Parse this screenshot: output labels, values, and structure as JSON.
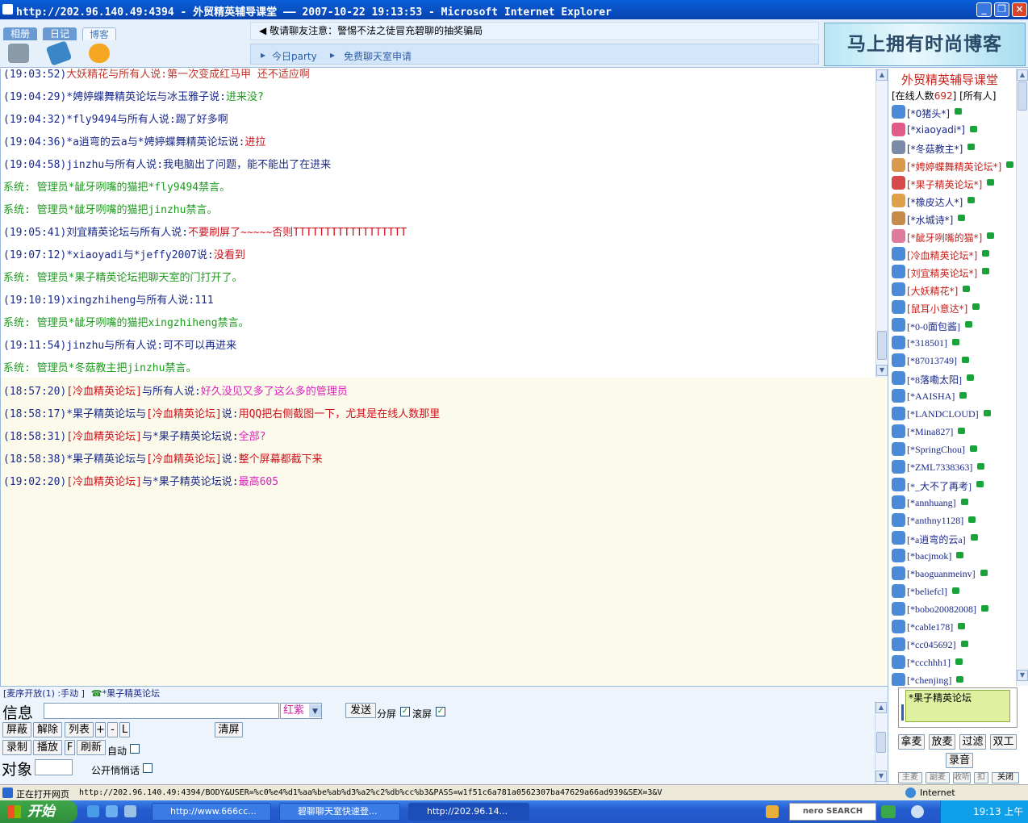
{
  "window": {
    "title": "http://202.96.140.49:4394 - 外贸精英辅导课堂 —— 2007-10-22 19:13:53 - Microsoft Internet Explorer"
  },
  "header": {
    "tabs": [
      "相册",
      "日记",
      "博客"
    ],
    "notice": "敬请聊友注意：警惕不法之徒冒充碧聊的抽奖骗局",
    "links": [
      "今日party",
      "免费聊天室申请"
    ],
    "banner": "马上拥有时尚博客"
  },
  "chat": {
    "lines": [
      {
        "time": "(19:03:52)",
        "text": "大妖精花与所有人说:第一次变成红马甲 还不适应啊"
      },
      {
        "time": "(19:04:29)",
        "sender": "*娉婷蝶舞精英论坛",
        "mid": "与冰玉雅子说:",
        "msg": "进来没?"
      },
      {
        "time": "(19:04:32)",
        "sender": "*fly9494",
        "mid": "与所有人说:",
        "msg": "踢了好多啊"
      },
      {
        "time": "(19:04:36)",
        "sender": "*a逍弯的云a",
        "mid": "与*娉婷蝶舞精英论坛说:",
        "msg": "进拉"
      },
      {
        "time": "(19:04:58)",
        "sender": "jinzhu",
        "mid": "与所有人说:",
        "msg": "我电脑出了问题，能不能出了在进来"
      },
      {
        "system": "系统:  管理员*龇牙咧嘴的猫把*fly9494禁言。"
      },
      {
        "system": "系统:  管理员*龇牙咧嘴的猫把jinzhu禁言。"
      },
      {
        "time": "(19:05:41)",
        "sender": "刘宜精英论坛",
        "mid": "与所有人说:",
        "msg": "不要刷屏了~~~~~否则TTTTTTTTTTTTTTTTTT"
      },
      {
        "time": "(19:07:12)",
        "sender": "*xiaoyadi",
        "mid": "与*jeffy2007说:",
        "msg": "没看到"
      },
      {
        "system": "系统:  管理员*果子精英论坛把聊天室的门打开了。"
      },
      {
        "time": "(19:10:19)",
        "sender": "xingzhiheng",
        "mid": "与所有人说:",
        "msg": "111"
      },
      {
        "system": "系统:  管理员*龇牙咧嘴的猫把xingzhiheng禁言。"
      },
      {
        "time": "(19:11:54)",
        "sender": "jinzhu",
        "mid": "与所有人说:",
        "msg": "可不可以再进来"
      },
      {
        "system": "系统:  管理员*冬菇教主把jinzhu禁言。"
      }
    ],
    "private_lines": [
      {
        "time": "(18:57:20)",
        "a": "[冷血精英论坛]",
        "mid": "与所有人说:",
        "msg": "好久没见又多了这么多的管理员"
      },
      {
        "time": "(18:58:17)",
        "a": "*果子精英论坛",
        "mid": "与",
        "b": "[冷血精英论坛]",
        "mid2": "说:",
        "msg": "用QQ把右侧截图一下，尤其是在线人数那里"
      },
      {
        "time": "(18:58:31)",
        "a": "[冷血精英论坛]",
        "mid": "与*果子精英论坛说:",
        "msg": "全部?"
      },
      {
        "time": "(18:58:38)",
        "a": "*果子精英论坛",
        "mid": "与",
        "b": "[冷血精英论坛]",
        "mid2": "说:",
        "msg": "整个屏幕都截下来"
      },
      {
        "time": "(19:02:20)",
        "a": "[冷血精英论坛]",
        "mid": "与*果子精英论坛说:",
        "msg": "最高605"
      }
    ]
  },
  "users": {
    "title": "外贸精英辅导课堂",
    "count_prefix": "[在线人数",
    "count": "692",
    "count_suffix": "] [所有人]",
    "list": [
      "[*0猪头*]",
      "[*xiaoyadi*]",
      "[*冬菇教主*]",
      "[*娉婷蝶舞精英论坛*]",
      "[*果子精英论坛*]",
      "[*橡皮达人*]",
      "[*水城诗*]",
      "[*龇牙咧嘴的猫*]",
      "[冷血精英论坛*]",
      "[刘宜精英论坛*]",
      "[大妖精花*]",
      "[鼠耳小意达*]",
      "[*0-0面包酱]",
      "[*318501]",
      "[*87013749]",
      "[*8落嘞太阳]",
      "[*AAISHA]",
      "[*LANDCLOUD]",
      "[*Mina827]",
      "[*SpringChou]",
      "[*ZML7338363]",
      "[*_大不了再考]",
      "[*annhuang]",
      "[*anthny1128]",
      "[*a逍弯的云a]",
      "[*bacjmok]",
      "[*baoguanmeinv]",
      "[*beliefcl]",
      "[*bobo20082008]",
      "[*cable178]",
      "[*cc045692]",
      "[*ccchhh1]",
      "[*chenjing]"
    ]
  },
  "input": {
    "status_prefix": "[麦序开放(1) :手动 ]",
    "current_user": "*果子精英论坛",
    "info_label": "信息",
    "color_value": "红紫",
    "send": "发送",
    "split_label": "分屏",
    "scroll_label": "滚屏",
    "buttons_row1": [
      "屏蔽",
      "解除",
      "列表",
      "+",
      "-",
      "L"
    ],
    "clear": "清屏",
    "buttons_row2": [
      "录制",
      "播放",
      "F",
      "刷新"
    ],
    "auto_label": "自动",
    "target_label": "对象",
    "whisper_label": "公开悄悄话",
    "selected_user": "*果子精英论坛",
    "mic_buttons": [
      "拿麦",
      "放麦",
      "过滤",
      "双工"
    ],
    "record": "录音",
    "tiny_buttons": [
      "主麦",
      "副麦",
      "收听",
      "扣",
      "关闭"
    ]
  },
  "status": {
    "text": "正在打开网页",
    "url": "http://202.96.140.49:4394/BODY&USER=%c0%e4%d1%aa%be%ab%d3%a2%c2%db%cc%b3&PASS=w1f51c6a781a0562307ba47629a66ad939&SEX=3&V",
    "zone": "Internet"
  },
  "taskbar": {
    "start": "开始",
    "tasks": [
      "http://www.666cc...",
      "碧聊聊天室快速登...",
      "http://202.96.14..."
    ],
    "search": "nero SEARCH",
    "clock": "19:13 上午"
  },
  "colors": {
    "system": "#1e9b1e",
    "sender": "#1a2a8a",
    "message": "#d0101c",
    "private_bg": "#fcfaea"
  }
}
